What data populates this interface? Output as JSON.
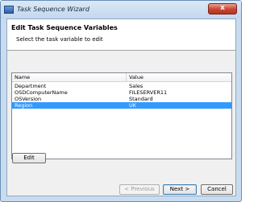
{
  "window": {
    "title": "Task Sequence Wizard",
    "close_label": "x"
  },
  "header": {
    "title": "Edit Task Sequence Variables",
    "subtitle": "Select the task variable to edit"
  },
  "table": {
    "columns": [
      "Name",
      "Value"
    ],
    "rows": [
      {
        "name": "Department",
        "value": "Sales"
      },
      {
        "name": "OSDComputerName",
        "value": "FILESERVER11"
      },
      {
        "name": "OSVersion",
        "value": "Standard"
      },
      {
        "name": "Region",
        "value": "UK"
      }
    ],
    "selected_row": 3
  },
  "buttons": {
    "edit": "Edit",
    "previous": "< Previous",
    "next": "Next >",
    "cancel": "Cancel"
  },
  "colors": {
    "selection": "#3399ff",
    "frame": "#c9dcef"
  }
}
